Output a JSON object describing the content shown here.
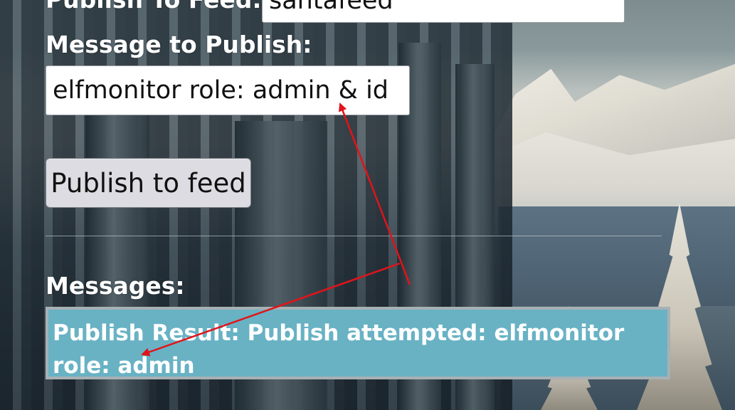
{
  "form": {
    "feed_label": "Publish To Feed:",
    "feed_value": "santafeed",
    "message_label": "Message to Publish:",
    "message_value": "elfmonitor role: admin & id",
    "publish_button": "Publish to feed"
  },
  "messages": {
    "label": "Messages:",
    "result_text": "Publish Result: Publish attempted: elfmonitor role: admin"
  },
  "annotation": {
    "arrow_color": "#e0141a"
  }
}
